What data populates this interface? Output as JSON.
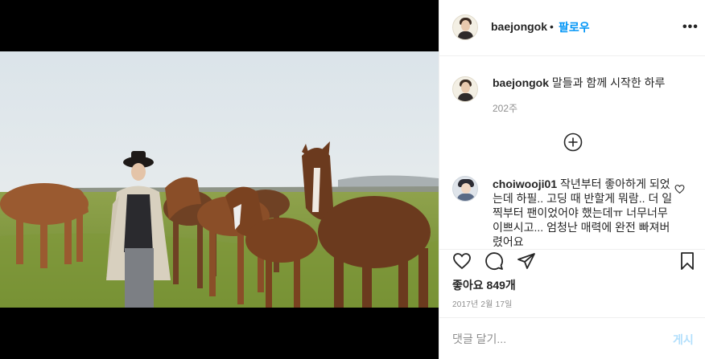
{
  "post": {
    "username": "baejongok",
    "follow_dot": "•",
    "follow_label": "팔로우",
    "more_label": "•••",
    "caption_text": "말들과 함께 시작한 하루",
    "caption_time": "202주",
    "comments": [
      {
        "username": "choiwooji01",
        "text": "작년부터 좋아하게 되었는데 하필.. 고딩 때 반할게 뭐람.. 더 일찍부터 팬이었어야 했는데ㅠ 너무너무 이쁘시고... 엄청난 매력에 완전 빠져버렸어요"
      }
    ],
    "likes_text": "좋아요 849개",
    "date_text": "2017년 2월 17일",
    "comment_placeholder": "댓글 달기...",
    "post_label": "게시"
  },
  "icons": {
    "load_more": "plus-circle-icon",
    "like": "heart-icon",
    "comment": "comment-icon",
    "share": "paper-plane-icon",
    "save": "bookmark-icon"
  },
  "colors": {
    "link_blue": "#0095f6",
    "post_disabled": "#b2dffc",
    "muted": "#8e8e8e"
  }
}
